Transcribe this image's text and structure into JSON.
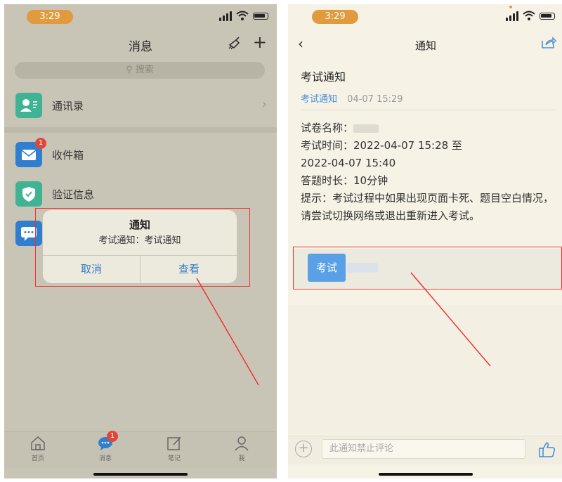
{
  "left": {
    "status": {
      "time": "3:29"
    },
    "nav": {
      "title": "消息"
    },
    "search": {
      "placeholder": "搜索"
    },
    "rows": [
      {
        "label": "通讯录",
        "icon": "contacts-icon",
        "color": "#3fb394"
      },
      {
        "label": "收件箱",
        "icon": "inbox-icon",
        "color": "#2f7fce",
        "badge": "1"
      },
      {
        "label": "验证信息",
        "icon": "shield-icon",
        "color": "#3fb394"
      },
      {
        "label": "",
        "icon": "chat-icon",
        "color": "#2f7fce"
      }
    ],
    "dialog": {
      "title": "通知",
      "message": "考试通知：考试通知",
      "cancel": "取消",
      "confirm": "查看"
    },
    "tabs": [
      {
        "label": "首页",
        "icon": "home-icon"
      },
      {
        "label": "消息",
        "icon": "message-icon",
        "badge": "1"
      },
      {
        "label": "笔记",
        "icon": "note-icon"
      },
      {
        "label": "我",
        "icon": "profile-icon"
      }
    ]
  },
  "right": {
    "status": {
      "time": "3:29"
    },
    "nav": {
      "title": "通知"
    },
    "heading": "考试通知",
    "tag": "考试通知",
    "datetime": "04-07 15:29",
    "body": {
      "paper_name": "试卷名称：",
      "exam_time_1": "考试时间：2022-04-07 15:28 至",
      "exam_time_2": "2022-04-07 15:40",
      "duration": "答题时长：10分钟",
      "tip": "提示：考试过程中如果出现页面卡死、题目空白情况，请尝试切换网络或退出重新进入考试。"
    },
    "exam_button": "考试",
    "comment": {
      "placeholder": "此通知禁止评论"
    }
  },
  "colors": {
    "accent_blue": "#3a7fc6",
    "time_pill": "#e29a3e",
    "badge_red": "#e0473b",
    "annotation_red": "#ee3333"
  }
}
